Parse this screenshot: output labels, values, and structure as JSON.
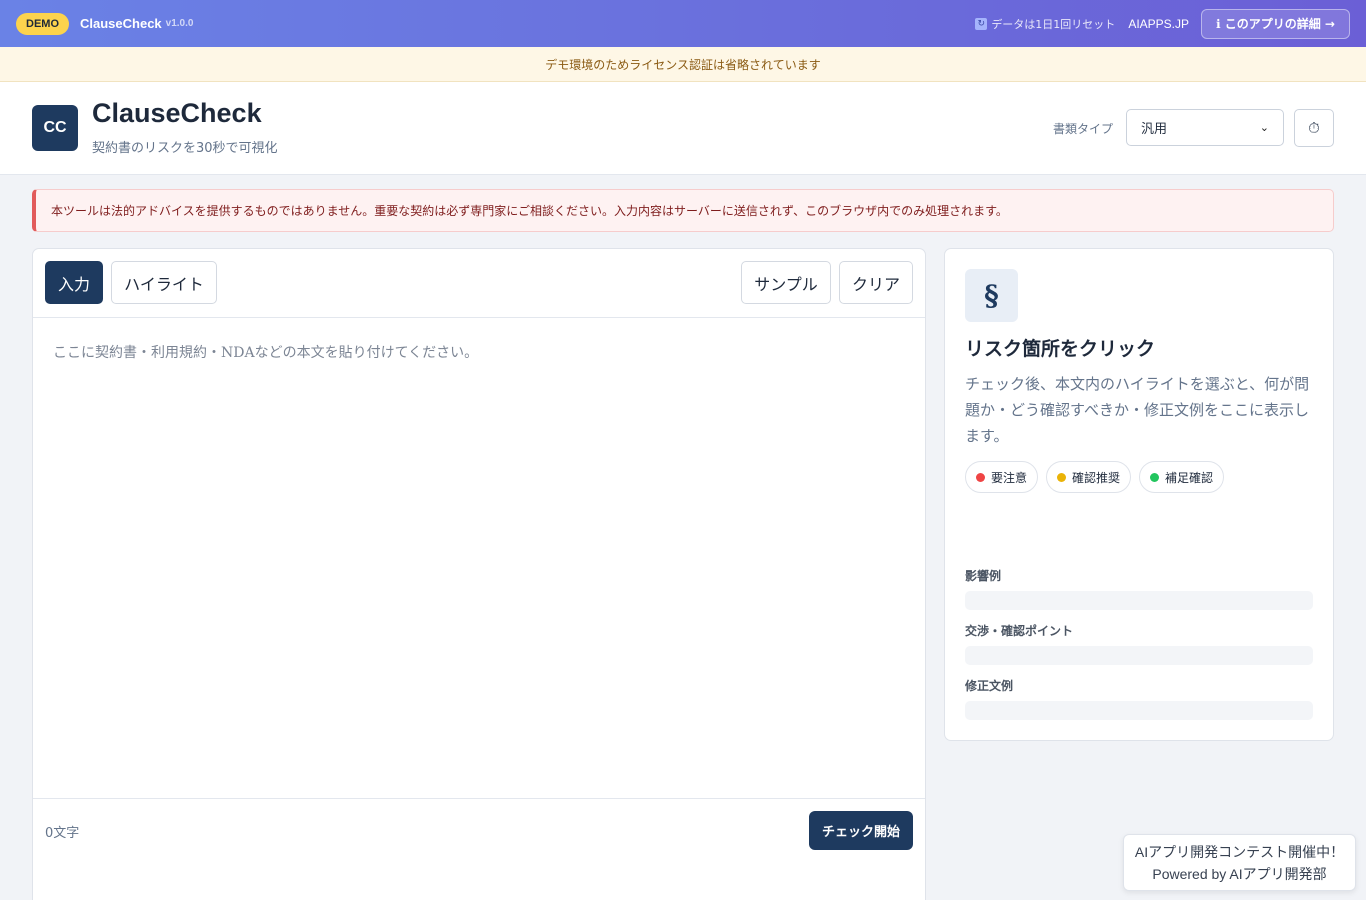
{
  "demo_bar": {
    "badge": "DEMO",
    "app_name": "ClauseCheck",
    "version": "v1.0.0",
    "reset_icon": "refresh-icon",
    "reset_note": "データは1日1回リセット",
    "site_link": "AIAPPS.JP",
    "detail_button": "ℹ このアプリの詳細 →"
  },
  "license_notice": "デモ環境のためライセンス認証は省略されています",
  "header": {
    "logo_text": "CC",
    "title": "ClauseCheck",
    "subtitle": "契約書のリスクを30秒で可視化",
    "doc_type_label": "書類タイプ",
    "doc_type_selected": "汎用",
    "history_icon": "⏱"
  },
  "disclaimer": "本ツールは法的アドバイスを提供するものではありません。重要な契約は必ず専門家にご相談ください。入力内容はサーバーに送信されず、このブラウザ内でのみ処理されます。",
  "editor": {
    "tabs": [
      {
        "label": "入力",
        "active": true
      },
      {
        "label": "ハイライト",
        "active": false
      }
    ],
    "sample_button": "サンプル",
    "clear_button": "クリア",
    "placeholder": "ここに契約書・利用規約・NDAなどの本文を貼り付けてください。",
    "char_count": "0文字",
    "check_button": "チェック開始"
  },
  "side_panel": {
    "icon": "§",
    "title": "リスク箇所をクリック",
    "description": "チェック後、本文内のハイライトを選ぶと、何が問題か・どう確認すべきか・修正文例をここに表示します。",
    "legend": [
      {
        "label": "要注意",
        "color": "#ef4444"
      },
      {
        "label": "確認推奨",
        "color": "#eab308"
      },
      {
        "label": "補足確認",
        "color": "#22c55e"
      }
    ],
    "fields": [
      "影響例",
      "交渉・確認ポイント",
      "修正文例"
    ]
  },
  "contest_note": {
    "line1": "AIアプリ開発コンテスト開催中！",
    "line2": "Powered by AIアプリ開発部"
  }
}
